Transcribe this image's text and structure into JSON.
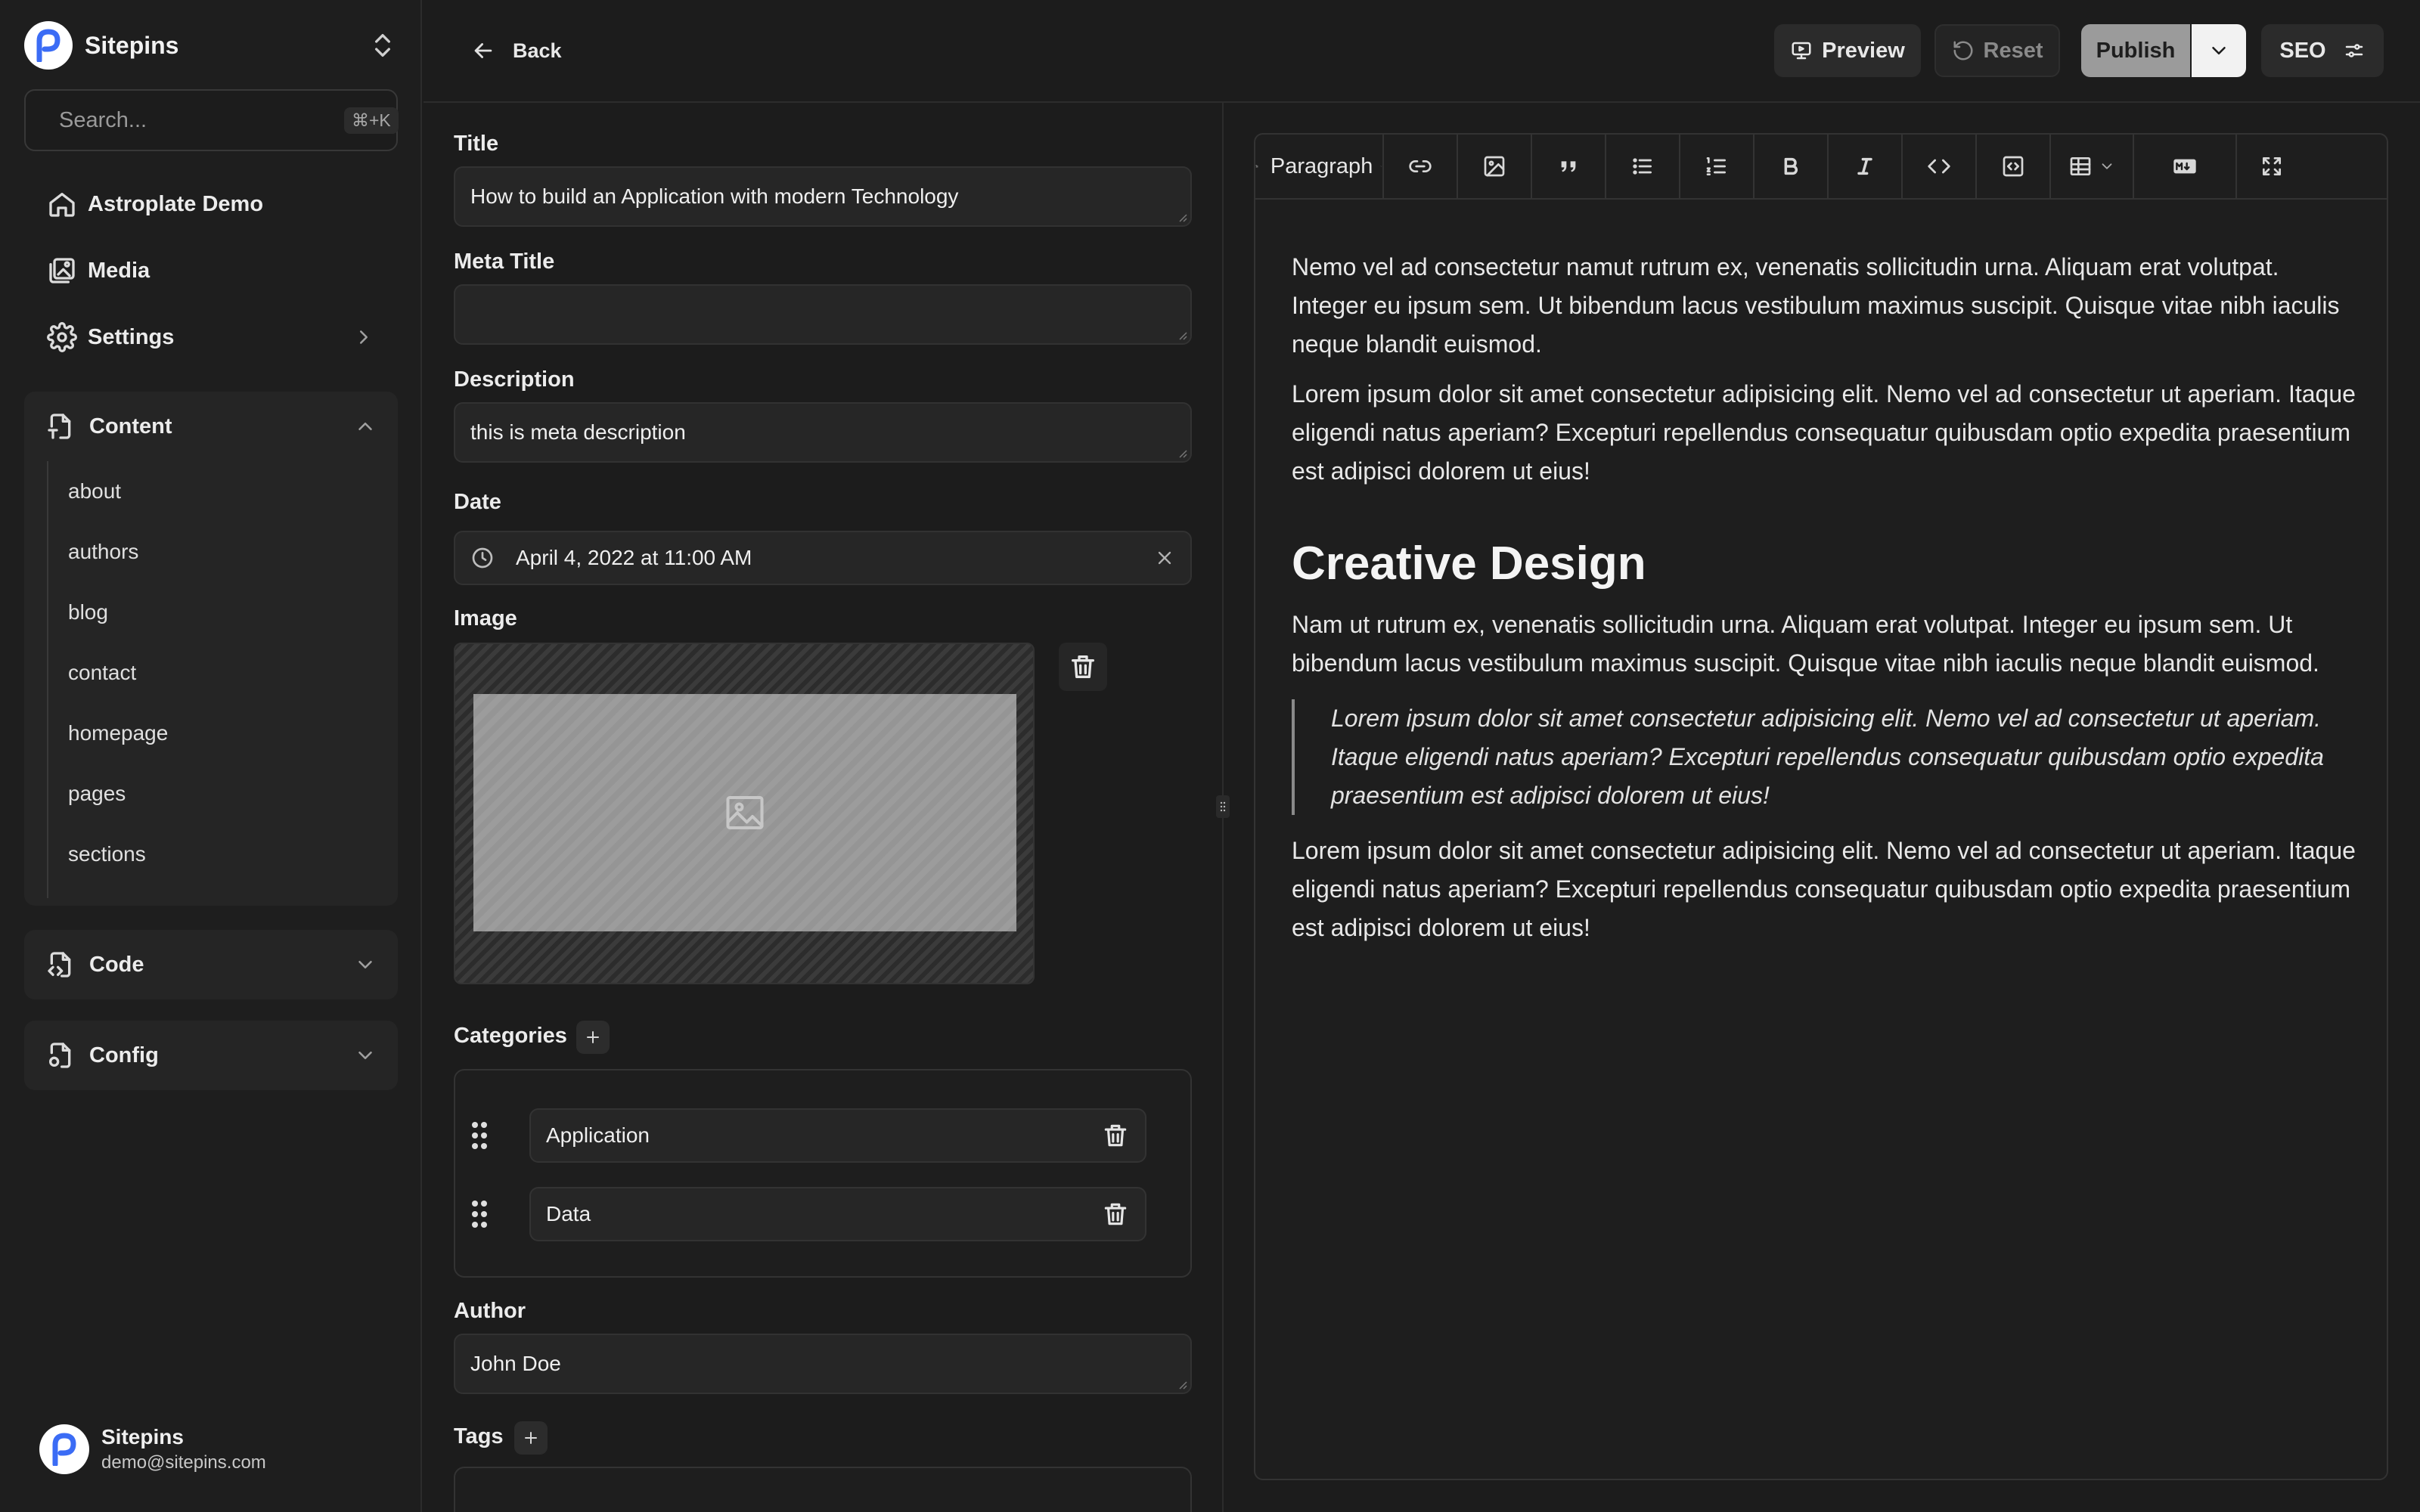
{
  "sidebar": {
    "brand": "Sitepins",
    "search": {
      "placeholder": "Search...",
      "shortcut": "⌘+K"
    },
    "nav": [
      {
        "label": "Astroplate Demo",
        "icon": "home-icon"
      },
      {
        "label": "Media",
        "icon": "media-icon"
      },
      {
        "label": "Settings",
        "icon": "gear-icon"
      }
    ],
    "content_group": {
      "label": "Content",
      "items": [
        "about",
        "authors",
        "blog",
        "contact",
        "homepage",
        "pages",
        "sections"
      ]
    },
    "code_group": {
      "label": "Code"
    },
    "config_group": {
      "label": "Config"
    },
    "user": {
      "name": "Sitepins",
      "email": "demo@sitepins.com"
    }
  },
  "topbar": {
    "back_label": "Back",
    "preview_label": "Preview",
    "reset_label": "Reset",
    "publish_label": "Publish",
    "seo_label": "SEO"
  },
  "form": {
    "title": {
      "label": "Title",
      "value": "How to build an Application with modern Technology"
    },
    "meta_title": {
      "label": "Meta Title",
      "value": ""
    },
    "description": {
      "label": "Description",
      "value": "this is meta description"
    },
    "date": {
      "label": "Date",
      "value": "April 4, 2022 at 11:00 AM"
    },
    "image": {
      "label": "Image"
    },
    "categories": {
      "label": "Categories",
      "items": [
        "Application",
        "Data"
      ]
    },
    "author": {
      "label": "Author",
      "value": "John Doe"
    },
    "tags": {
      "label": "Tags"
    }
  },
  "editor": {
    "block_type": "Paragraph",
    "content": {
      "p1": "Nemo vel ad consectetur namut rutrum ex, venenatis sollicitudin urna. Aliquam erat volutpat. Integer eu ipsum sem. Ut bibendum lacus vestibulum maximus suscipit. Quisque vitae nibh iaculis neque blandit euismod.",
      "p2": "Lorem ipsum dolor sit amet consectetur adipisicing elit. Nemo vel ad consectetur ut aperiam. Itaque eligendi natus aperiam? Excepturi repellendus consequatur quibusdam optio expedita praesentium est adipisci dolorem ut eius!",
      "heading": "Creative Design",
      "p3": "Nam ut rutrum ex, venenatis sollicitudin urna. Aliquam erat volutpat. Integer eu ipsum sem. Ut bibendum lacus vestibulum maximus suscipit. Quisque vitae nibh iaculis neque blandit euismod.",
      "quote": "Lorem ipsum dolor sit amet consectetur adipisicing elit. Nemo vel ad consectetur ut aperiam. Itaque eligendi natus aperiam? Excepturi repellendus consequatur quibusdam optio expedita praesentium est adipisci dolorem ut eius!",
      "p4": "Lorem ipsum dolor sit amet consectetur adipisicing elit. Nemo vel ad consectetur ut aperiam. Itaque eligendi natus aperiam? Excepturi repellendus consequatur quibusdam optio expedita praesentium est adipisci dolorem ut eius!"
    }
  },
  "colors": {
    "background": "#1c1c1c",
    "panel": "#252525",
    "publish": "#9b9b9b"
  }
}
